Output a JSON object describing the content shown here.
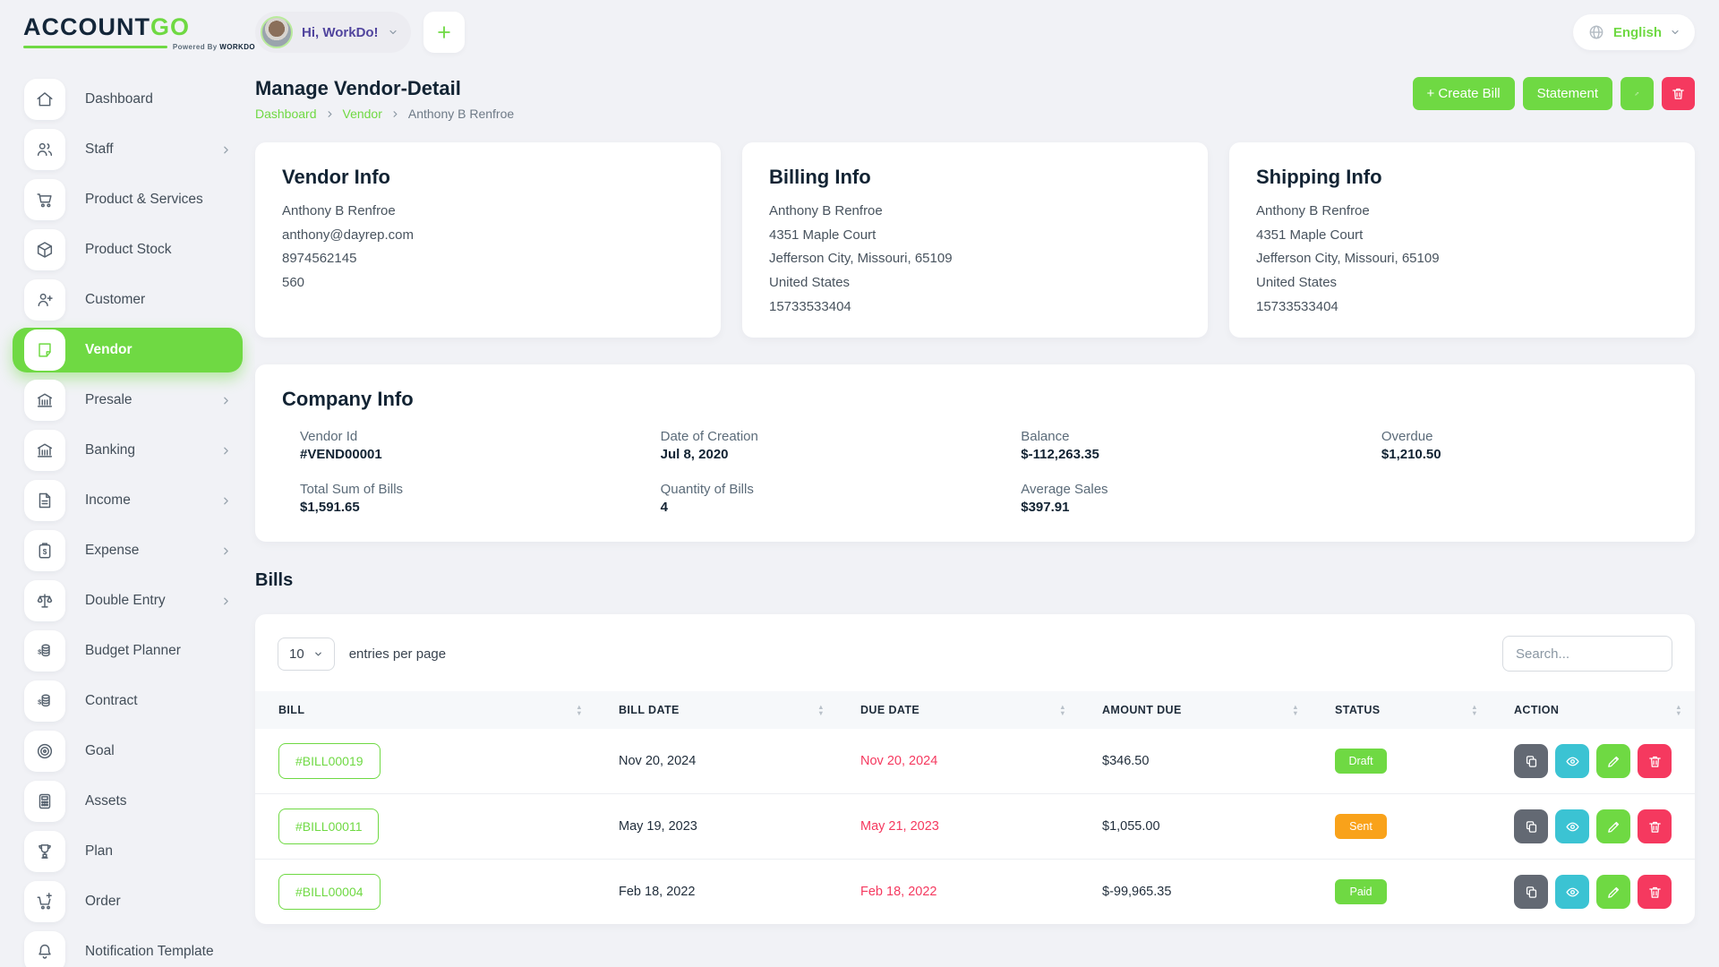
{
  "brand": {
    "name_primary": "ACCOUNT",
    "name_accent": "GO",
    "powered_prefix": "Powered By",
    "powered_brand": "WORKDO"
  },
  "header": {
    "greeting": "Hi, WorkDo!",
    "language": "English"
  },
  "sidebar": {
    "items": [
      {
        "label": "Dashboard",
        "icon": "home-icon",
        "has_submenu": false,
        "active": false
      },
      {
        "label": "Staff",
        "icon": "users-icon",
        "has_submenu": true,
        "active": false
      },
      {
        "label": "Product & Services",
        "icon": "cart-icon",
        "has_submenu": false,
        "active": false
      },
      {
        "label": "Product Stock",
        "icon": "cube-icon",
        "has_submenu": false,
        "active": false
      },
      {
        "label": "Customer",
        "icon": "user-plus-icon",
        "has_submenu": false,
        "active": false
      },
      {
        "label": "Vendor",
        "icon": "note-icon",
        "has_submenu": false,
        "active": true
      },
      {
        "label": "Presale",
        "icon": "bank-icon",
        "has_submenu": true,
        "active": false
      },
      {
        "label": "Banking",
        "icon": "bank-icon",
        "has_submenu": true,
        "active": false
      },
      {
        "label": "Income",
        "icon": "file-icon",
        "has_submenu": true,
        "active": false
      },
      {
        "label": "Expense",
        "icon": "clipboard-dollar-icon",
        "has_submenu": true,
        "active": false
      },
      {
        "label": "Double Entry",
        "icon": "scale-icon",
        "has_submenu": true,
        "active": false
      },
      {
        "label": "Budget Planner",
        "icon": "coins-icon",
        "has_submenu": false,
        "active": false
      },
      {
        "label": "Contract",
        "icon": "coins-icon",
        "has_submenu": false,
        "active": false
      },
      {
        "label": "Goal",
        "icon": "target-icon",
        "has_submenu": false,
        "active": false
      },
      {
        "label": "Assets",
        "icon": "calculator-icon",
        "has_submenu": false,
        "active": false
      },
      {
        "label": "Plan",
        "icon": "trophy-icon",
        "has_submenu": false,
        "active": false
      },
      {
        "label": "Order",
        "icon": "cart-plus-icon",
        "has_submenu": false,
        "active": false
      },
      {
        "label": "Notification Template",
        "icon": "bell-icon",
        "has_submenu": false,
        "active": false
      }
    ]
  },
  "page": {
    "title": "Manage Vendor-Detail",
    "breadcrumb_home": "Dashboard",
    "breadcrumb_section": "Vendor",
    "breadcrumb_current": "Anthony B Renfroe"
  },
  "actions": {
    "create_bill": "+ Create Bill",
    "statement": "Statement",
    "edit_icon": "pencil-icon",
    "delete_icon": "trash-icon"
  },
  "vendor_info": {
    "title": "Vendor Info",
    "lines": [
      "Anthony B Renfroe",
      "anthony@dayrep.com",
      "8974562145",
      "560"
    ]
  },
  "billing_info": {
    "title": "Billing Info",
    "lines": [
      "Anthony B Renfroe",
      "4351 Maple Court",
      "Jefferson City, Missouri, 65109",
      "United States",
      "15733533404"
    ]
  },
  "shipping_info": {
    "title": "Shipping Info",
    "lines": [
      "Anthony B Renfroe",
      "4351 Maple Court",
      "Jefferson City, Missouri, 65109",
      "United States",
      "15733533404"
    ]
  },
  "company_info": {
    "title": "Company Info",
    "columns": [
      [
        {
          "label": "Vendor Id",
          "value": "#VEND00001"
        },
        {
          "label": "Total Sum of Bills",
          "value": "$1,591.65"
        }
      ],
      [
        {
          "label": "Date of Creation",
          "value": "Jul 8, 2020"
        },
        {
          "label": "Quantity of Bills",
          "value": "4"
        }
      ],
      [
        {
          "label": "Balance",
          "value": "$-112,263.35"
        },
        {
          "label": "Average Sales",
          "value": "$397.91"
        }
      ],
      [
        {
          "label": "Overdue",
          "value": "$1,210.50"
        }
      ]
    ]
  },
  "bills": {
    "section_title": "Bills",
    "page_size": "10",
    "entries_label": "entries per page",
    "search_placeholder": "Search...",
    "columns": [
      "BILL",
      "BILL DATE",
      "DUE DATE",
      "AMOUNT DUE",
      "STATUS",
      "ACTION"
    ],
    "rows": [
      {
        "bill": "#BILL00019",
        "bill_date": "Nov 20, 2024",
        "due_date": "Nov 20, 2024",
        "amount_due": "$346.50",
        "status": "Draft",
        "status_color": "#6fd943"
      },
      {
        "bill": "#BILL00011",
        "bill_date": "May 19, 2023",
        "due_date": "May 21, 2023",
        "amount_due": "$1,055.00",
        "status": "Sent",
        "status_color": "#f9a21a"
      },
      {
        "bill": "#BILL00004",
        "bill_date": "Feb 18, 2022",
        "due_date": "Feb 18, 2022",
        "amount_due": "$-99,965.35",
        "status": "Paid",
        "status_color": "#6fd943"
      }
    ],
    "row_actions": [
      "duplicate-icon",
      "eye-icon",
      "pencil-icon",
      "trash-icon"
    ]
  },
  "colors": {
    "primary_green": "#6fd943",
    "danger_pink": "#f5395f",
    "info_cyan": "#3bc3d3",
    "warning_orange": "#f9a21a",
    "secondary_slate": "#636973",
    "heading_navy": "#122333"
  }
}
